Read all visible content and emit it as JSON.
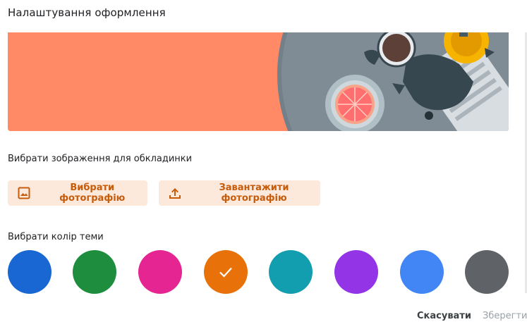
{
  "dialog": {
    "title": "Налаштування оформлення",
    "cover_section_label": "Вибрати зображення для обкладинки",
    "select_photo_label": "Вибрати фотографію",
    "upload_photo_label": "Завантажити фотографію",
    "color_section_label": "Вибрати колір теми",
    "cancel_label": "Скасувати",
    "save_label": "Зберегти"
  },
  "banner": {
    "background_color": "#ff8a65"
  },
  "theme_colors": [
    {
      "name": "blue",
      "color": "#1967d2",
      "selected": false
    },
    {
      "name": "green",
      "color": "#1e8e3e",
      "selected": false
    },
    {
      "name": "pink",
      "color": "#e52592",
      "selected": false
    },
    {
      "name": "orange",
      "color": "#e8710a",
      "selected": true
    },
    {
      "name": "teal",
      "color": "#129eaf",
      "selected": false
    },
    {
      "name": "purple",
      "color": "#9334e6",
      "selected": false
    },
    {
      "name": "light-blue",
      "color": "#4285f4",
      "selected": false
    },
    {
      "name": "grey",
      "color": "#5f6368",
      "selected": false
    }
  ],
  "icons": {
    "select_photo": "image-icon",
    "upload_photo": "upload-icon",
    "selected_swatch": "check-icon"
  }
}
